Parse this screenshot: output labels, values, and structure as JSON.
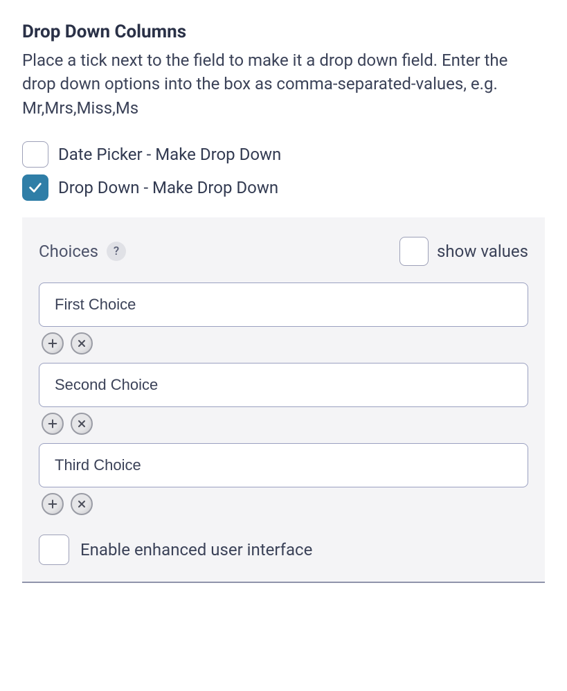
{
  "heading": "Drop Down Columns",
  "description": "Place a tick next to the field to make it a drop down field. Enter the drop down options into the box as comma-separated-values, e.g. Mr,Mrs,Miss,Ms",
  "fields": [
    {
      "label": "Date Picker - Make Drop Down",
      "checked": false
    },
    {
      "label": "Drop Down - Make Drop Down",
      "checked": true
    }
  ],
  "choices": {
    "label": "Choices",
    "help_symbol": "?",
    "show_values_label": "show values",
    "show_values_checked": false,
    "items": [
      "First Choice",
      "Second Choice",
      "Third Choice"
    ],
    "enable_enhanced_ui_label": "Enable enhanced user interface",
    "enable_enhanced_ui_checked": false
  }
}
